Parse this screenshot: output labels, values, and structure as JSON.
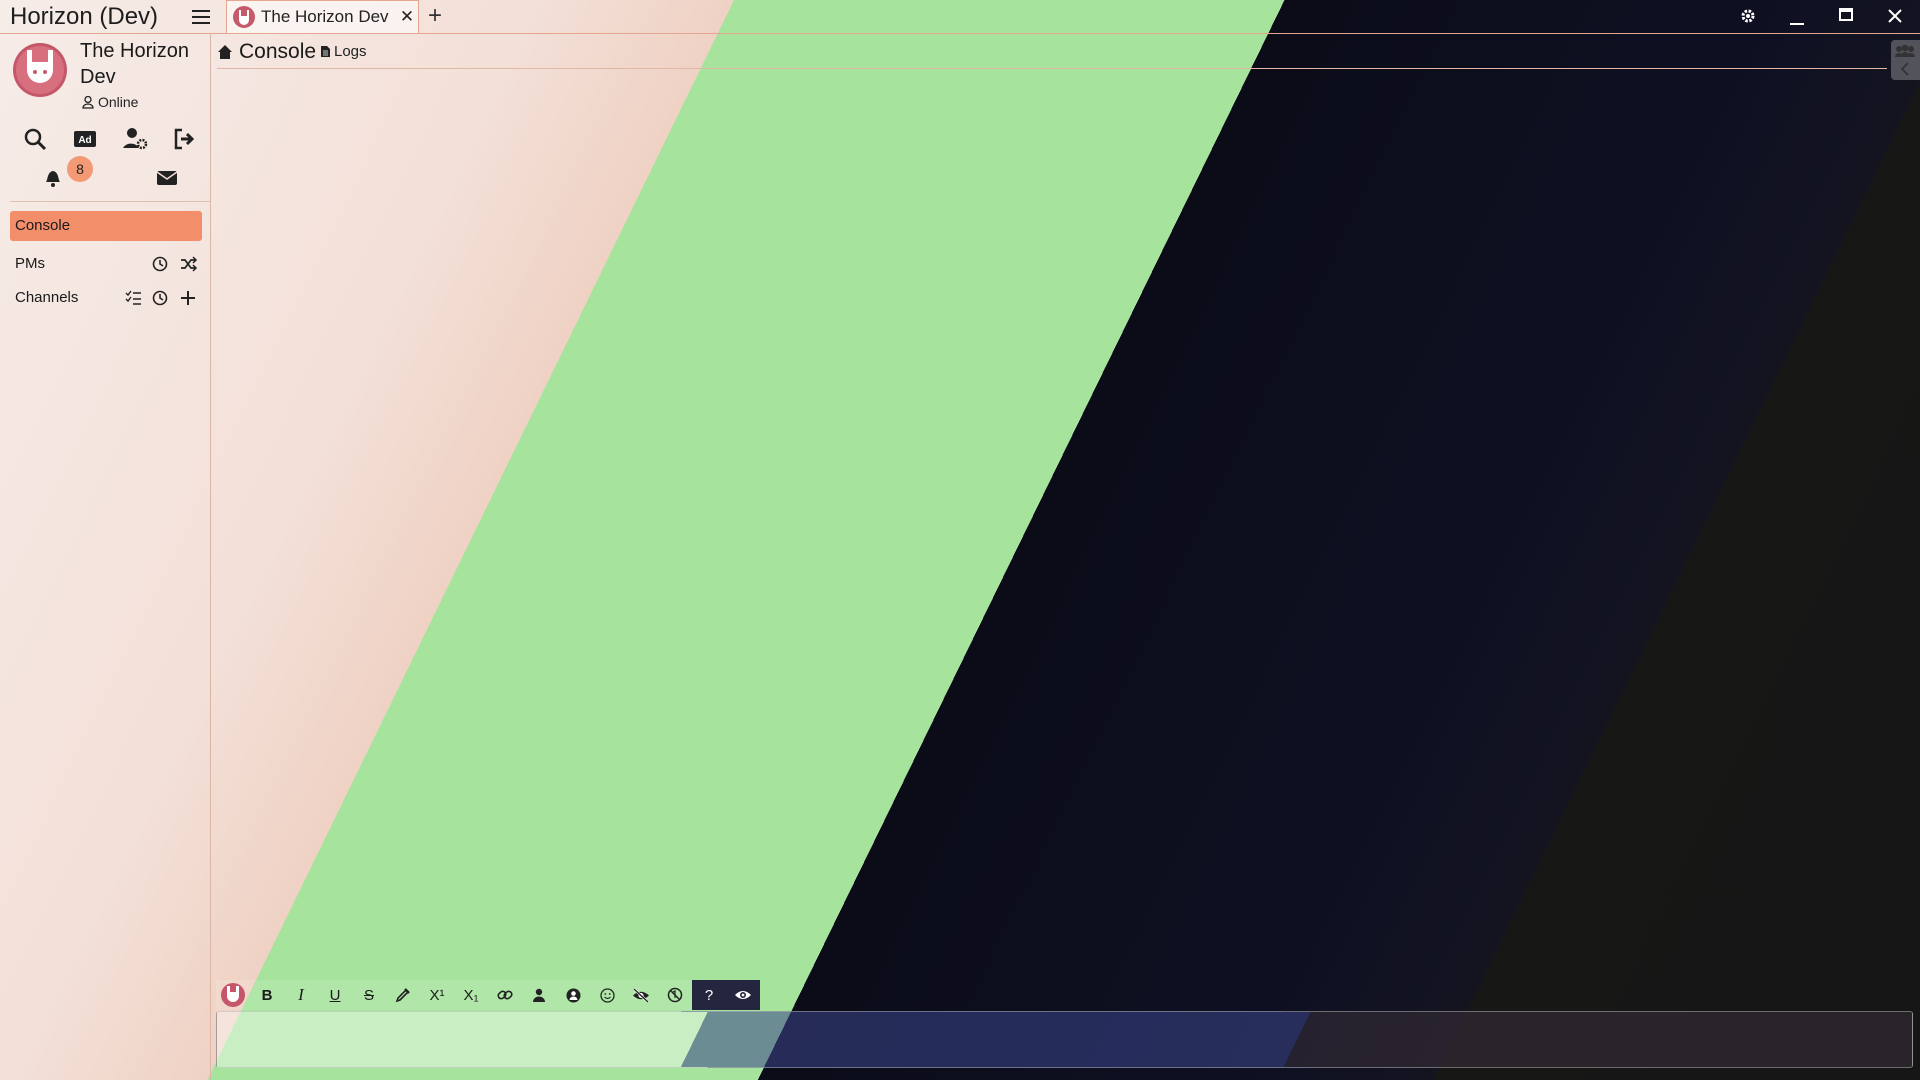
{
  "window": {
    "app_title": "Horizon (Dev)"
  },
  "tabs": [
    {
      "label": "The Horizon Dev"
    }
  ],
  "character": {
    "name": "The Horizon Dev",
    "status": "Online"
  },
  "notifications": {
    "count": "8"
  },
  "nav": {
    "console": "Console",
    "pms": "PMs",
    "channels": "Channels"
  },
  "header": {
    "title": "Console",
    "logs": "Logs"
  },
  "toolbar": {
    "bold": "B",
    "italic": "I",
    "underline": "U",
    "strike": "S",
    "sup": "X¹",
    "sub": "X₁",
    "help": "?"
  },
  "colors": {
    "accent": "#f38e6b",
    "badge": "#f39a74"
  }
}
